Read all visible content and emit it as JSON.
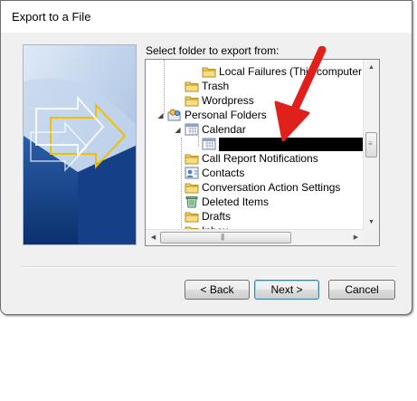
{
  "dialog": {
    "title": "Export to a File"
  },
  "prompt": "Select folder to export from:",
  "tree": {
    "items": [
      {
        "label": "Local Failures (This computer on",
        "icon": "folder-icon"
      },
      {
        "label": "Trash",
        "icon": "folder-icon"
      },
      {
        "label": "Wordpress",
        "icon": "folder-icon"
      },
      {
        "label": "Personal Folders",
        "icon": "personal-folders-icon",
        "expanded": true
      },
      {
        "label": "Calendar",
        "icon": "calendar-icon",
        "expanded": true
      },
      {
        "label": "",
        "icon": "calendar-icon",
        "selected": true,
        "redacted": true
      },
      {
        "label": "Call Report Notifications",
        "icon": "folder-icon"
      },
      {
        "label": "Contacts",
        "icon": "contacts-icon"
      },
      {
        "label": "Conversation Action Settings",
        "icon": "folder-icon"
      },
      {
        "label": "Deleted Items",
        "icon": "deleted-items-icon"
      },
      {
        "label": "Drafts",
        "icon": "folder-icon"
      },
      {
        "label": "Inbox",
        "icon": "folder-icon"
      }
    ]
  },
  "buttons": {
    "back": "< Back",
    "next": "Next >",
    "cancel": "Cancel"
  },
  "colors": {
    "annotation_arrow": "#e0201b",
    "redaction": "#000000",
    "selection": "#cce8ff"
  }
}
